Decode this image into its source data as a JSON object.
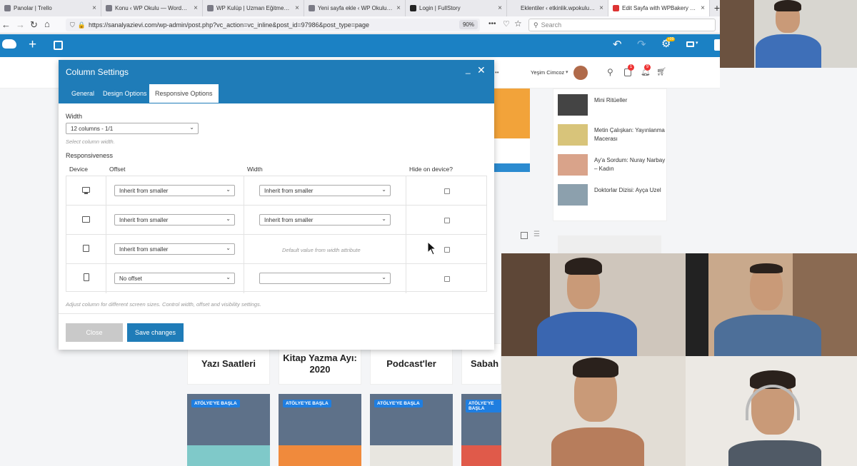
{
  "browser": {
    "tabs": [
      {
        "label": "Panolar | Trello",
        "active": false
      },
      {
        "label": "Konu ‹ WP Okulu — WordPress",
        "active": false
      },
      {
        "label": "WP Kulüp | Uzman Eğitmen | P",
        "active": false
      },
      {
        "label": "Yeni sayfa ekle ‹ WP Okulu —",
        "active": false
      },
      {
        "label": "Login | FullStory",
        "active": false
      },
      {
        "label": "Eklentiler ‹ etkinlik.wpokulu.co",
        "active": false
      },
      {
        "label": "Edit Sayfa with WPBakery Page",
        "active": true
      }
    ],
    "url": "https://sanalyazievi.com/wp-admin/post.php?vc_action=vc_inline&post_id=97986&post_type=page",
    "zoom": "90%",
    "search_placeholder": "Search"
  },
  "site": {
    "user_name": "Yeşim Cimcoz",
    "badge_count_1": "1",
    "badge_count_2": "9",
    "wp_updates_badge": "+99",
    "sidebar_items": [
      "Mini Ritüeller",
      "Metin Çalışkan: Yayınlanma Macerası",
      "Ay'a Sordum: Nuray Narbay – Kadın",
      "Doktorlar Dizisi: Ayça Uzel"
    ],
    "cards": [
      "Yazı Saatleri",
      "Kitap Yazma Ayı: 2020",
      "Podcast'ler",
      "Sabah S"
    ],
    "image_card_badge": "ATÖLYE'YE BAŞLA"
  },
  "modal": {
    "title": "Column Settings",
    "tabs": [
      "General",
      "Design Options",
      "Responsive Options"
    ],
    "active_tab": "Responsive Options",
    "width_label": "Width",
    "width_value": "12 columns - 1/1",
    "width_hint": "Select column width.",
    "responsiveness_label": "Responsiveness",
    "table_headers": {
      "device": "Device",
      "offset": "Offset",
      "width": "Width",
      "hide": "Hide on device?"
    },
    "rows": [
      {
        "device": "desktop-icon",
        "offset": "Inherit from smaller",
        "width": "Inherit from smaller"
      },
      {
        "device": "tablet-landscape-icon",
        "offset": "Inherit from smaller",
        "width": "Inherit from smaller"
      },
      {
        "device": "tablet-portrait-icon",
        "offset": "Inherit from smaller",
        "width_text": "Default value from width attribute"
      },
      {
        "device": "mobile-icon",
        "offset": "No offset",
        "width": ""
      }
    ],
    "footer_hint": "Adjust column for different screen sizes. Control width, offset and visibility settings.",
    "close_label": "Close",
    "save_label": "Save changes"
  },
  "colors": {
    "accent": "#1f7cb8",
    "wpbar": "#1b81c4"
  }
}
